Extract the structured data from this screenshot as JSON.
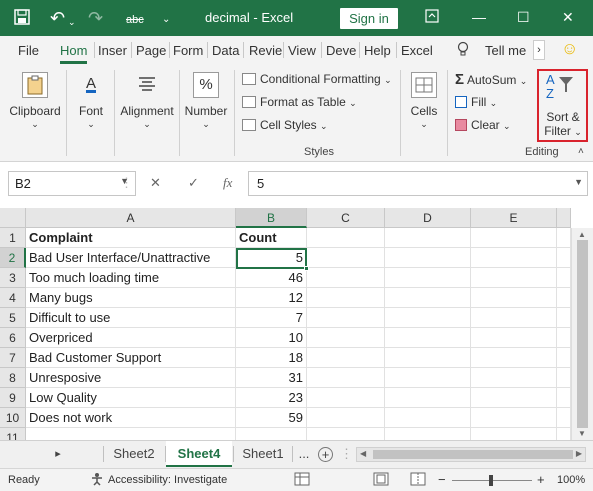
{
  "titlebar": {
    "save_icon": "save-icon",
    "undo_glyph": "↶",
    "redo_glyph": "↷",
    "spell_label": "abc",
    "more_glyph": "⌄",
    "title": "decimal  -  Excel",
    "signin_label": "Sign in",
    "minimize_glyph": "—",
    "maximize_glyph": "☐",
    "close_glyph": "✕"
  },
  "tabs": [
    {
      "label": "File"
    },
    {
      "label": "Hom",
      "active": true
    },
    {
      "label": "Inser"
    },
    {
      "label": "Page"
    },
    {
      "label": "Form"
    },
    {
      "label": "Data"
    },
    {
      "label": "Revie"
    },
    {
      "label": "View"
    },
    {
      "label": "Deve"
    },
    {
      "label": "Help"
    },
    {
      "label": "Excel"
    }
  ],
  "tellme_label": "Tell me",
  "tellme_icon": "lightbulb-icon",
  "ribbon": {
    "clipboard": "Clipboard",
    "font": "Font",
    "alignment": "Alignment",
    "number": "Number",
    "number_glyph": "%",
    "font_glyph": "A",
    "conditional_formatting": "Conditional Formatting",
    "format_as_table": "Format as Table",
    "cell_styles": "Cell Styles",
    "styles_group": "Styles",
    "cells": "Cells",
    "autosum": "AutoSum",
    "autosum_glyph": "Σ",
    "fill": "Fill",
    "clear": "Clear",
    "sort_filter_line1": "Sort &",
    "sort_filter_line2": "Filter",
    "editing_group": "Editing",
    "sort_a": "A",
    "sort_z": "Z",
    "chevron": "⌄"
  },
  "formula_bar": {
    "name_box": "B2",
    "cancel_glyph": "✕",
    "enter_glyph": "✓",
    "fx_label": "fx",
    "value": "5"
  },
  "columns": [
    "A",
    "B",
    "C",
    "D",
    "E"
  ],
  "rows": [
    {
      "num": "1",
      "a": "Complaint",
      "b": "Count",
      "bold": true
    },
    {
      "num": "2",
      "a": "Bad User Interface/Unattractive",
      "b": "5"
    },
    {
      "num": "3",
      "a": "Too much loading time",
      "b": "46"
    },
    {
      "num": "4",
      "a": "Many bugs",
      "b": "12"
    },
    {
      "num": "5",
      "a": "Difficult to use",
      "b": "7"
    },
    {
      "num": "6",
      "a": "Overpriced",
      "b": "10"
    },
    {
      "num": "7",
      "a": "Bad Customer Support",
      "b": "18"
    },
    {
      "num": "8",
      "a": "Unresposive",
      "b": "31"
    },
    {
      "num": "9",
      "a": "Low Quality",
      "b": "23"
    },
    {
      "num": "10",
      "a": "Does not work",
      "b": "59"
    },
    {
      "num": "11",
      "a": "",
      "b": ""
    }
  ],
  "sheets": {
    "tabs": [
      "Sheet2",
      "Sheet4",
      "Sheet1"
    ],
    "active": "Sheet4",
    "next_glyph": "▸",
    "ellipsis": "...",
    "add_glyph": "+"
  },
  "status": {
    "ready": "Ready",
    "accessibility": "Accessibility: Investigate",
    "zoom": "100%",
    "minus": "−",
    "plus": "+"
  },
  "colors": {
    "accent": "#217346",
    "highlight_border": "#d9232d"
  }
}
